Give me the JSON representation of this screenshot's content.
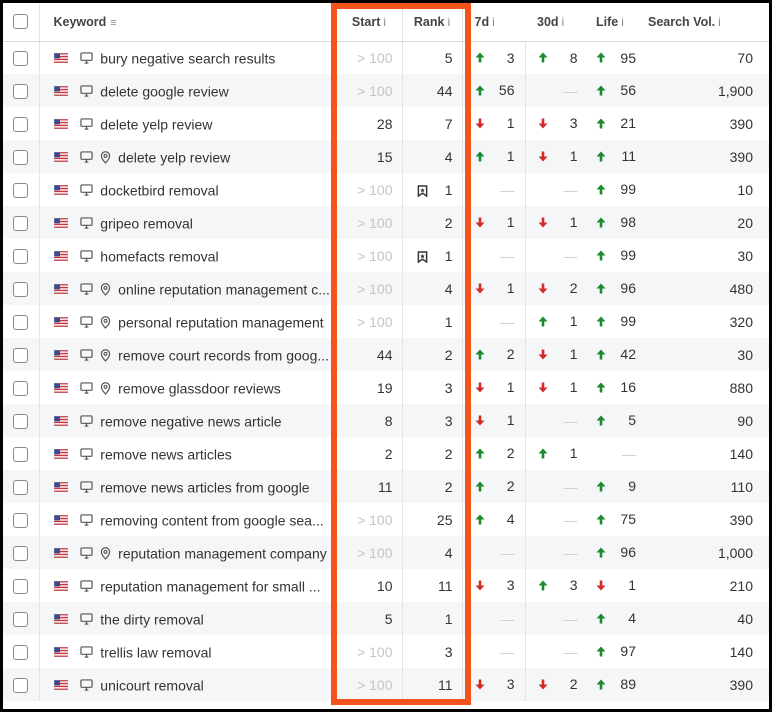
{
  "columns": {
    "keyword": "Keyword",
    "start": "Start",
    "rank": "Rank",
    "d7": "7d",
    "d30": "30d",
    "life": "Life",
    "volume": "Search Vol.",
    "info_glyph": "i"
  },
  "colors": {
    "up": "#1a8a2e",
    "down": "#d22b2b",
    "highlight": "#f2541b"
  },
  "rows": [
    {
      "keyword": "bury negative search results",
      "local": false,
      "start": "> 100",
      "start_na": true,
      "rank": "5",
      "bookmark": false,
      "d7": {
        "dir": "up",
        "val": "3"
      },
      "d30": {
        "dir": "up",
        "val": "8"
      },
      "life": {
        "dir": "up",
        "val": "95"
      },
      "volume": "70"
    },
    {
      "keyword": "delete google review",
      "local": false,
      "start": "> 100",
      "start_na": true,
      "rank": "44",
      "bookmark": false,
      "d7": {
        "dir": "up",
        "val": "56"
      },
      "d30": {
        "dir": "none",
        "val": "—"
      },
      "life": {
        "dir": "up",
        "val": "56"
      },
      "volume": "1,900"
    },
    {
      "keyword": "delete yelp review",
      "local": false,
      "start": "28",
      "start_na": false,
      "rank": "7",
      "bookmark": false,
      "d7": {
        "dir": "down",
        "val": "1"
      },
      "d30": {
        "dir": "down",
        "val": "3"
      },
      "life": {
        "dir": "up",
        "val": "21"
      },
      "volume": "390"
    },
    {
      "keyword": "delete yelp review",
      "local": true,
      "start": "15",
      "start_na": false,
      "rank": "4",
      "bookmark": false,
      "d7": {
        "dir": "up",
        "val": "1"
      },
      "d30": {
        "dir": "down",
        "val": "1"
      },
      "life": {
        "dir": "up",
        "val": "11"
      },
      "volume": "390"
    },
    {
      "keyword": "docketbird removal",
      "local": false,
      "start": "> 100",
      "start_na": true,
      "rank": "1",
      "bookmark": true,
      "d7": {
        "dir": "none",
        "val": "—"
      },
      "d30": {
        "dir": "none",
        "val": "—"
      },
      "life": {
        "dir": "up",
        "val": "99"
      },
      "volume": "10"
    },
    {
      "keyword": "gripeo removal",
      "local": false,
      "start": "> 100",
      "start_na": true,
      "rank": "2",
      "bookmark": false,
      "d7": {
        "dir": "down",
        "val": "1"
      },
      "d30": {
        "dir": "down",
        "val": "1"
      },
      "life": {
        "dir": "up",
        "val": "98"
      },
      "volume": "20"
    },
    {
      "keyword": "homefacts removal",
      "local": false,
      "start": "> 100",
      "start_na": true,
      "rank": "1",
      "bookmark": true,
      "d7": {
        "dir": "none",
        "val": "—"
      },
      "d30": {
        "dir": "none",
        "val": "—"
      },
      "life": {
        "dir": "up",
        "val": "99"
      },
      "volume": "30"
    },
    {
      "keyword": "online reputation management c...",
      "local": true,
      "start": "> 100",
      "start_na": true,
      "rank": "4",
      "bookmark": false,
      "d7": {
        "dir": "down",
        "val": "1"
      },
      "d30": {
        "dir": "down",
        "val": "2"
      },
      "life": {
        "dir": "up",
        "val": "96"
      },
      "volume": "480"
    },
    {
      "keyword": "personal reputation management",
      "local": true,
      "start": "> 100",
      "start_na": true,
      "rank": "1",
      "bookmark": false,
      "d7": {
        "dir": "none",
        "val": "—"
      },
      "d30": {
        "dir": "up",
        "val": "1"
      },
      "life": {
        "dir": "up",
        "val": "99"
      },
      "volume": "320"
    },
    {
      "keyword": "remove court records from goog...",
      "local": true,
      "start": "44",
      "start_na": false,
      "rank": "2",
      "bookmark": false,
      "d7": {
        "dir": "up",
        "val": "2"
      },
      "d30": {
        "dir": "down",
        "val": "1"
      },
      "life": {
        "dir": "up",
        "val": "42"
      },
      "volume": "30"
    },
    {
      "keyword": "remove glassdoor reviews",
      "local": true,
      "start": "19",
      "start_na": false,
      "rank": "3",
      "bookmark": false,
      "d7": {
        "dir": "down",
        "val": "1"
      },
      "d30": {
        "dir": "down",
        "val": "1"
      },
      "life": {
        "dir": "up",
        "val": "16"
      },
      "volume": "880"
    },
    {
      "keyword": "remove negative news article",
      "local": false,
      "start": "8",
      "start_na": false,
      "rank": "3",
      "bookmark": false,
      "d7": {
        "dir": "down",
        "val": "1"
      },
      "d30": {
        "dir": "none",
        "val": "—"
      },
      "life": {
        "dir": "up",
        "val": "5"
      },
      "volume": "90"
    },
    {
      "keyword": "remove news articles",
      "local": false,
      "start": "2",
      "start_na": false,
      "rank": "2",
      "bookmark": false,
      "d7": {
        "dir": "up",
        "val": "2"
      },
      "d30": {
        "dir": "up",
        "val": "1"
      },
      "life": {
        "dir": "none",
        "val": "—"
      },
      "volume": "140"
    },
    {
      "keyword": "remove news articles from google",
      "local": false,
      "start": "11",
      "start_na": false,
      "rank": "2",
      "bookmark": false,
      "d7": {
        "dir": "up",
        "val": "2"
      },
      "d30": {
        "dir": "none",
        "val": "—"
      },
      "life": {
        "dir": "up",
        "val": "9"
      },
      "volume": "110"
    },
    {
      "keyword": "removing content from google sea...",
      "local": false,
      "start": "> 100",
      "start_na": true,
      "rank": "25",
      "bookmark": false,
      "d7": {
        "dir": "up",
        "val": "4"
      },
      "d30": {
        "dir": "none",
        "val": "—"
      },
      "life": {
        "dir": "up",
        "val": "75"
      },
      "volume": "390"
    },
    {
      "keyword": "reputation management company",
      "local": true,
      "start": "> 100",
      "start_na": true,
      "rank": "4",
      "bookmark": false,
      "d7": {
        "dir": "none",
        "val": "—"
      },
      "d30": {
        "dir": "none",
        "val": "—"
      },
      "life": {
        "dir": "up",
        "val": "96"
      },
      "volume": "1,000"
    },
    {
      "keyword": "reputation management for small ...",
      "local": false,
      "start": "10",
      "start_na": false,
      "rank": "11",
      "bookmark": false,
      "d7": {
        "dir": "down",
        "val": "3"
      },
      "d30": {
        "dir": "up",
        "val": "3"
      },
      "life": {
        "dir": "down",
        "val": "1"
      },
      "volume": "210"
    },
    {
      "keyword": "the dirty removal",
      "local": false,
      "start": "5",
      "start_na": false,
      "rank": "1",
      "bookmark": false,
      "d7": {
        "dir": "none",
        "val": "—"
      },
      "d30": {
        "dir": "none",
        "val": "—"
      },
      "life": {
        "dir": "up",
        "val": "4"
      },
      "volume": "40"
    },
    {
      "keyword": "trellis law removal",
      "local": false,
      "start": "> 100",
      "start_na": true,
      "rank": "3",
      "bookmark": false,
      "d7": {
        "dir": "none",
        "val": "—"
      },
      "d30": {
        "dir": "none",
        "val": "—"
      },
      "life": {
        "dir": "up",
        "val": "97"
      },
      "volume": "140"
    },
    {
      "keyword": "unicourt removal",
      "local": false,
      "start": "> 100",
      "start_na": true,
      "rank": "11",
      "bookmark": false,
      "d7": {
        "dir": "down",
        "val": "3"
      },
      "d30": {
        "dir": "down",
        "val": "2"
      },
      "life": {
        "dir": "up",
        "val": "89"
      },
      "volume": "390"
    }
  ]
}
